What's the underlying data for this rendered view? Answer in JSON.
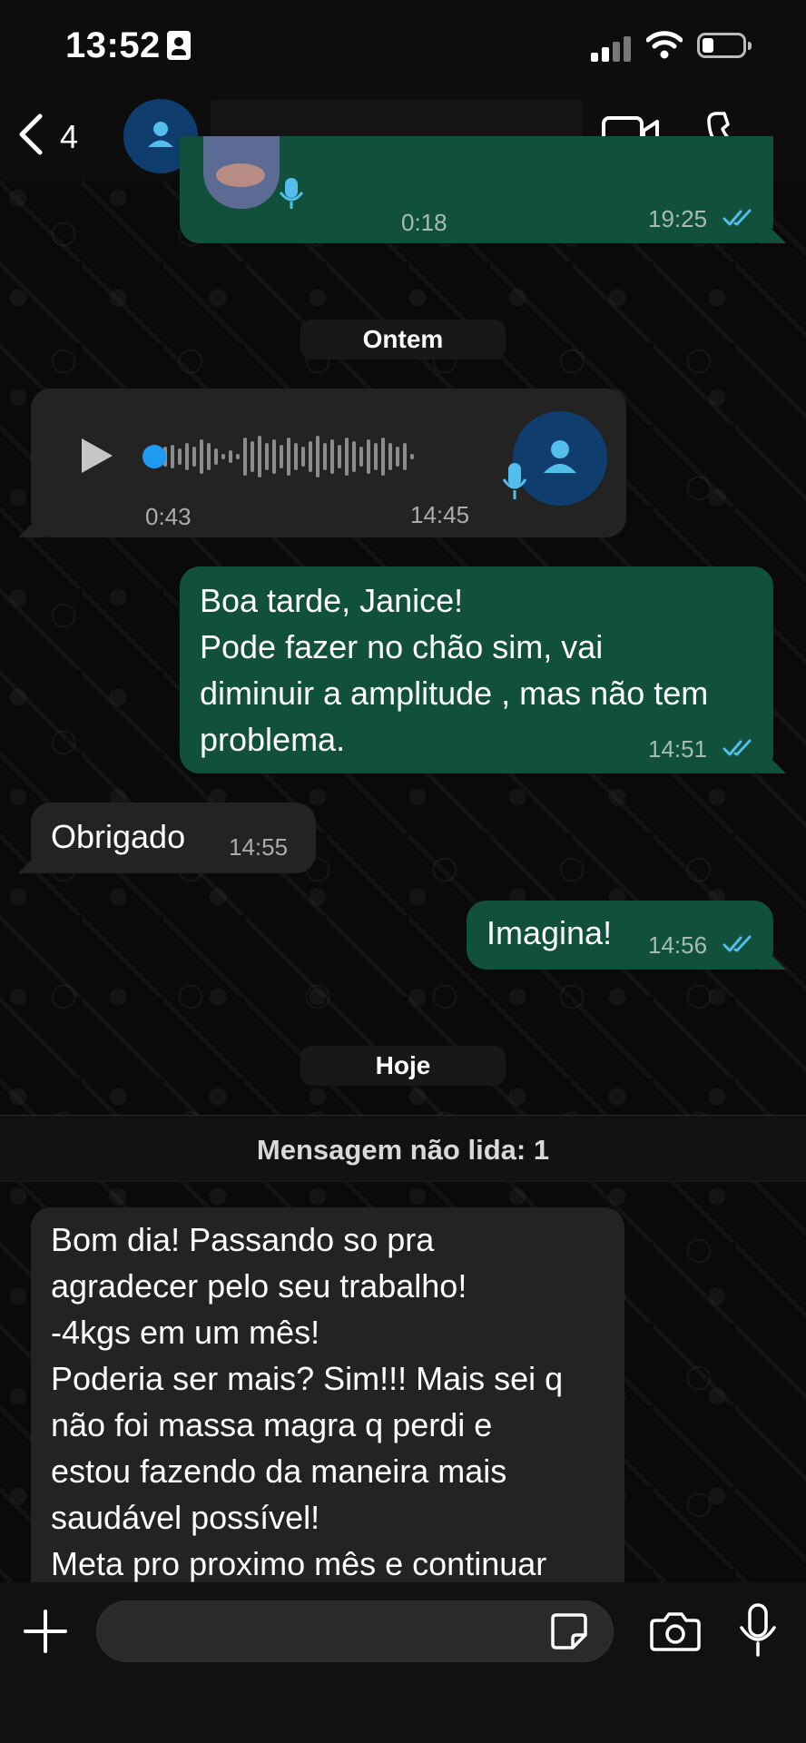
{
  "status_bar": {
    "time": "13:52",
    "battery_level_fraction": 0.2
  },
  "header": {
    "back_count": "4"
  },
  "messages": {
    "top_voice": {
      "duration": "0:18",
      "time": "19:25"
    },
    "date_yesterday": "Ontem",
    "voice_note": {
      "duration": "0:43",
      "time": "14:45"
    },
    "msg1": {
      "lines": [
        "Boa tarde, Janice!",
        "Pode fazer no chão sim, vai",
        "diminuir a amplitude , mas não tem",
        "problema."
      ],
      "time": "14:51"
    },
    "msg2": {
      "text": "Obrigado",
      "time": "14:55"
    },
    "msg3": {
      "text": "Imagina!",
      "time": "14:56"
    },
    "date_today": "Hoje",
    "unread_label": "Mensagem não lida: 1",
    "msg4": {
      "lines": [
        "Bom dia! Passando so pra",
        "agradecer pelo seu trabalho!",
        "-4kgs em um mês!",
        "Poderia ser mais? Sim!!! Mais sei q",
        "não foi massa magra q perdi e",
        "estou fazendo da maneira mais",
        "saudável possível!",
        "Meta pro proximo mês e continuar"
      ]
    }
  },
  "input": {
    "value": "",
    "placeholder": ""
  },
  "colors": {
    "outgoing_bubble": "#11503b",
    "incoming_bubble": "#232323",
    "read_ticks": "#53bdeb",
    "avatar_bg": "#0f3d6e"
  },
  "icons": [
    "back-chevron-icon",
    "person-icon",
    "video-camera-icon",
    "phone-icon",
    "play-icon",
    "microphone-icon",
    "double-check-icon",
    "plus-icon",
    "sticker-icon",
    "camera-icon"
  ]
}
